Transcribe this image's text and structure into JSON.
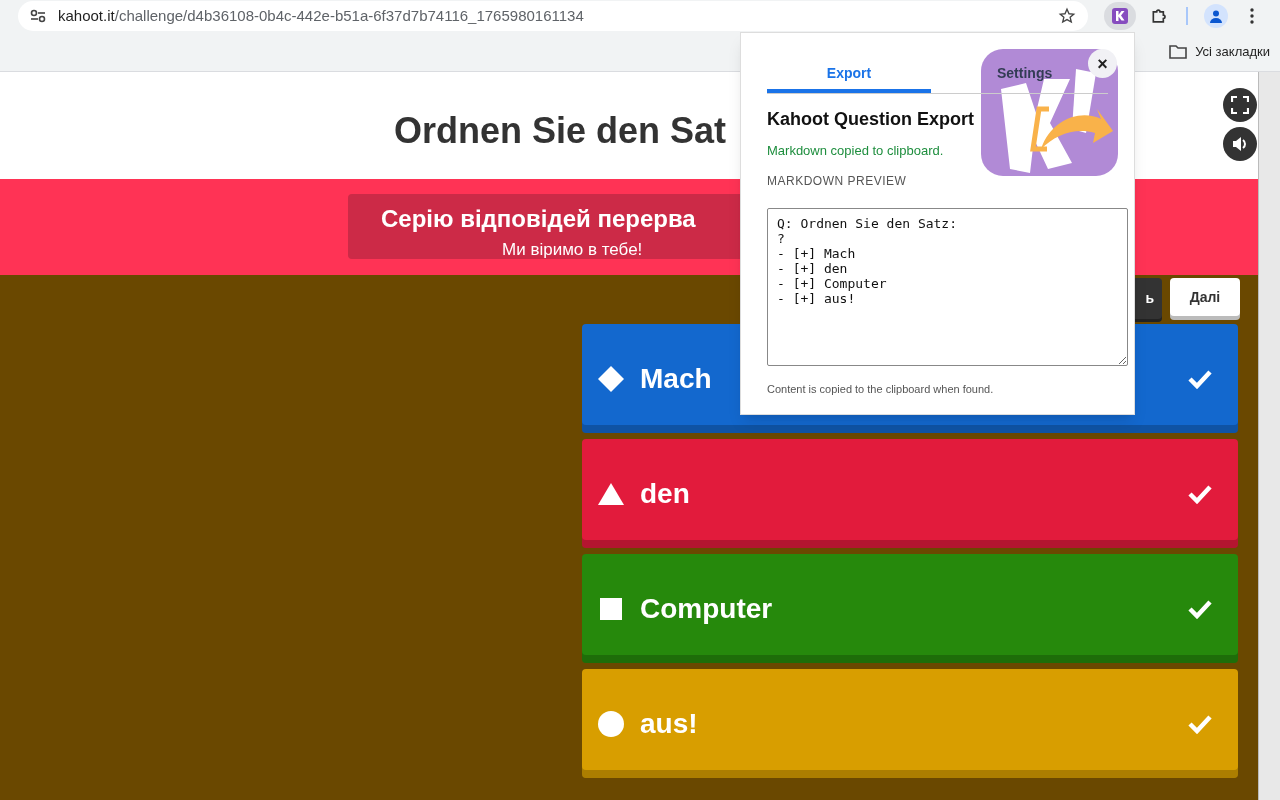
{
  "browser": {
    "url_host": "kahoot.it",
    "url_path": "/challenge/d4b36108-0b4c-442e-b51a-6f37d7b74116_1765980161134",
    "bookmarks_label": "Усі закладки"
  },
  "page": {
    "title": "Ordnen Sie den Sat",
    "banner_title": "Серію відповідей перерва",
    "banner_subtitle": "Ми віримо в тебе!",
    "dark_button": "ь",
    "next_button": "Далі",
    "answers": [
      {
        "kind": "diamond",
        "text": "Mach",
        "color": "#1368ce",
        "correct": true
      },
      {
        "kind": "triangle",
        "text": "den",
        "color": "#e21b3c",
        "correct": true
      },
      {
        "kind": "square",
        "text": "Computer",
        "color": "#26890c",
        "correct": true
      },
      {
        "kind": "circle",
        "text": "aus!",
        "color": "#d89e00",
        "correct": true
      }
    ]
  },
  "popup": {
    "tabs": [
      {
        "label": "Export",
        "selected": true
      },
      {
        "label": "Settings",
        "selected": false
      }
    ],
    "close": "×",
    "heading": "Kahoot Question Export",
    "status": "Markdown copied to clipboard.",
    "preview_label": "MARKDOWN PREVIEW",
    "preview": "Q: Ordnen Sie den Satz:\n?\n- [+] Mach\n- [+] den\n- [+] Computer\n- [+] aus!",
    "footer": "Content is copied to the clipboard when found."
  }
}
